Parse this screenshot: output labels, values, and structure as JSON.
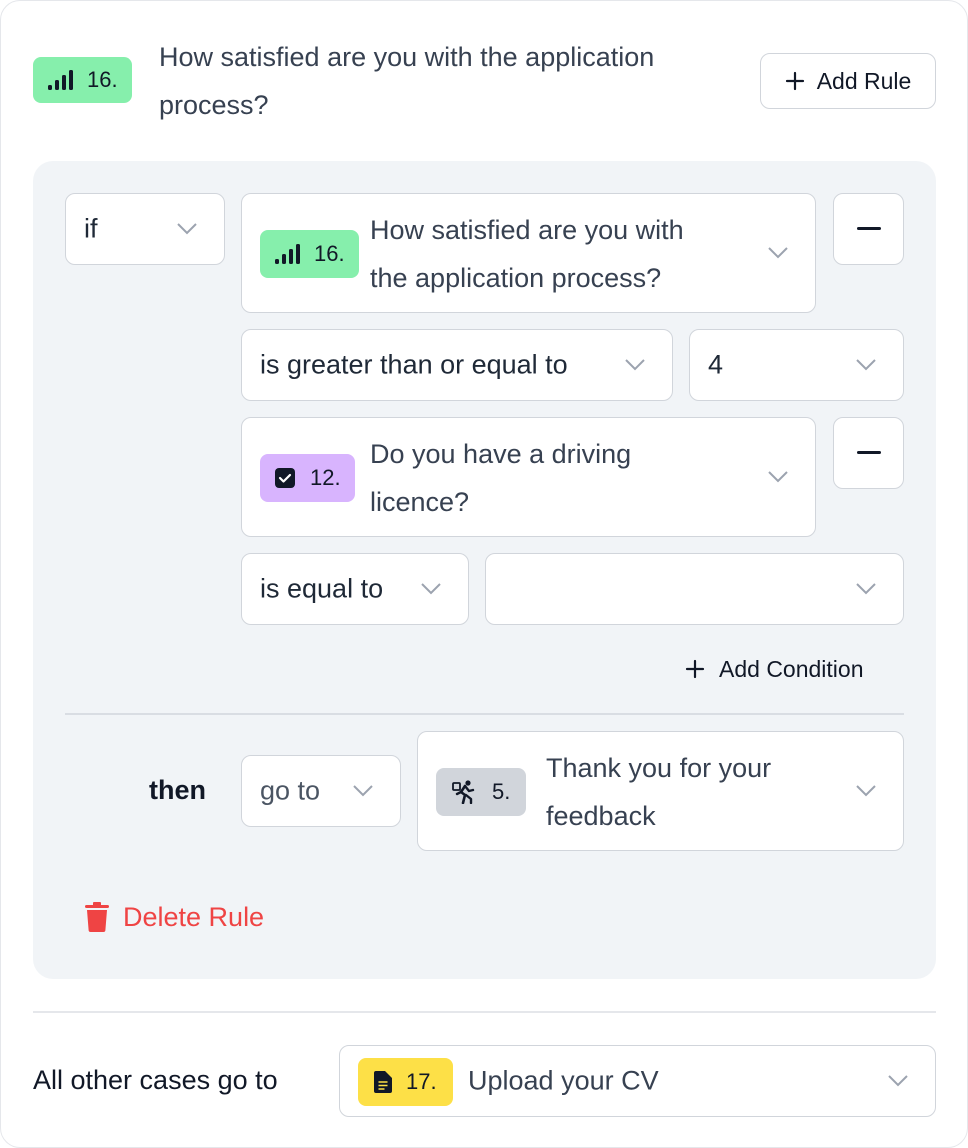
{
  "header": {
    "badge_number": "16.",
    "question": "How satisfied are you with the application process?",
    "question_line1": "How satisfied are you with the application",
    "question_line2": "process?",
    "add_rule_label": "Add Rule",
    "badge_color": "#86efac"
  },
  "rule": {
    "logic_value": "if",
    "conditions": [
      {
        "question_badge": "16.",
        "question_line1": "How satisfied are you with",
        "question_line2": "the application process?",
        "badge_icon": "signal-bars-icon",
        "badge_color": "#86efac",
        "operator": "is greater than or equal to",
        "value": "4"
      },
      {
        "question_badge": "12.",
        "question_line1": "Do you have a driving",
        "question_line2": "licence?",
        "badge_icon": "checkbox-icon",
        "badge_color": "#d8b4fe",
        "operator": "is equal to",
        "value": ""
      }
    ],
    "add_condition_label": "Add Condition",
    "then_label": "then",
    "action": "go to",
    "target": {
      "badge": "5.",
      "badge_icon": "running-person-icon",
      "badge_color": "#d1d5db",
      "line1": "Thank you for your",
      "line2": "feedback"
    },
    "delete_rule_label": "Delete Rule",
    "delete_color": "#ef4444"
  },
  "fallback": {
    "label": "All other cases go to",
    "badge": "17.",
    "badge_icon": "document-icon",
    "badge_color": "#fde047",
    "target": "Upload your CV"
  }
}
